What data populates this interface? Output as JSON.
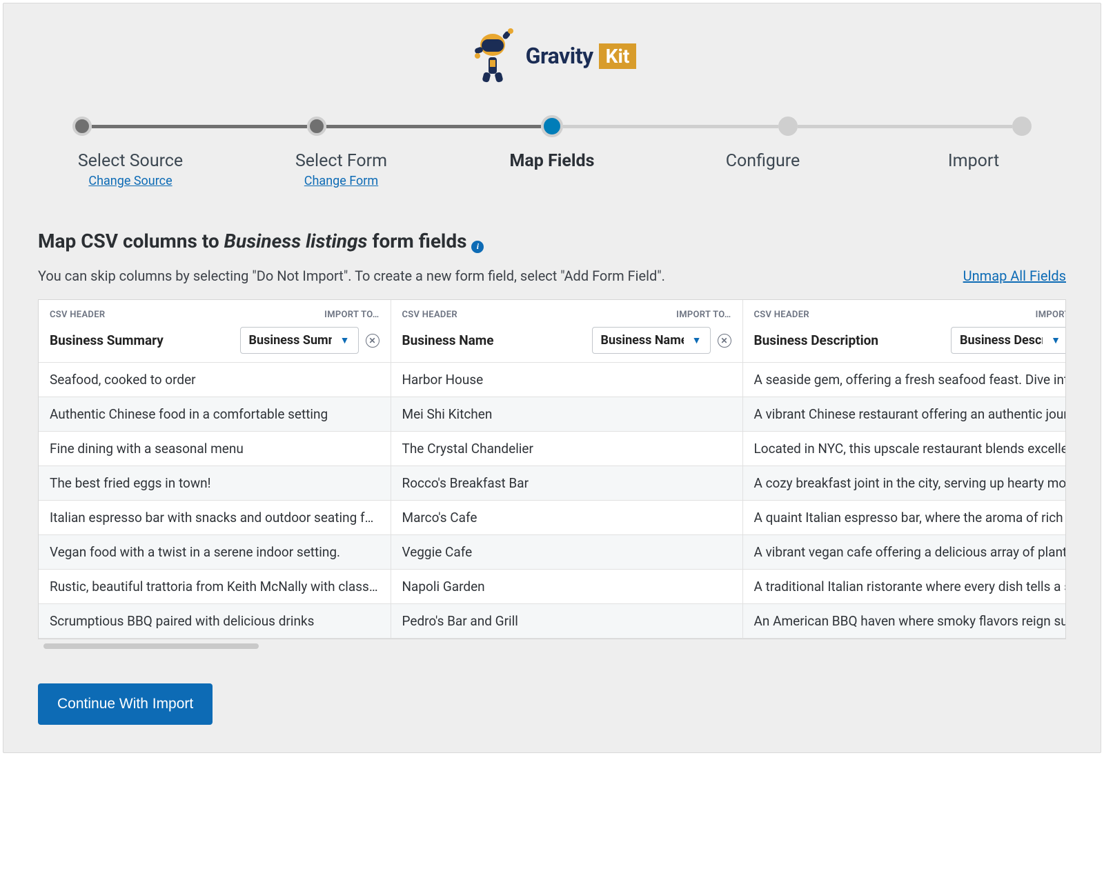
{
  "logo": {
    "brand_left": "Gravity",
    "brand_right": "Kit"
  },
  "steps": [
    {
      "title": "Select Source",
      "action": "Change Source",
      "state": "done"
    },
    {
      "title": "Select Form",
      "action": "Change Form",
      "state": "done"
    },
    {
      "title": "Map Fields",
      "action": "",
      "state": "current"
    },
    {
      "title": "Configure",
      "action": "",
      "state": "todo"
    },
    {
      "title": "Import",
      "action": "",
      "state": "todo"
    }
  ],
  "heading": {
    "prefix": "Map CSV columns to ",
    "form_name": "Business listings",
    "suffix": " form fields"
  },
  "subtext": "You can skip columns by selecting \"Do Not Import\". To create a new form field, select \"Add Form Field\".",
  "unmap_label": "Unmap All Fields",
  "labels": {
    "csv_header": "CSV HEADER",
    "import_to": "IMPORT TO…"
  },
  "columns": [
    {
      "csv_header": "Business Summary",
      "import_to": "Business Summary"
    },
    {
      "csv_header": "Business Name",
      "import_to": "Business Name"
    },
    {
      "csv_header": "Business Description",
      "import_to": "Business Description"
    }
  ],
  "rows": [
    {
      "c0": "Seafood, cooked to order",
      "c1": "Harbor House",
      "c2": "A seaside gem, offering a fresh seafood feast. Dive into the ocean's bounty."
    },
    {
      "c0": "Authentic Chinese food in a comfortable setting",
      "c1": "Mei Shi Kitchen",
      "c2": "A vibrant Chinese restaurant offering an authentic journey through flavors."
    },
    {
      "c0": "Fine dining with a seasonal menu",
      "c1": "The Crystal Chandelier",
      "c2": "Located in NYC, this upscale restaurant blends excellent service with fine dining."
    },
    {
      "c0": "The best fried eggs in town!",
      "c1": "Rocco's Breakfast Bar",
      "c2": "A cozy breakfast joint in the city, serving up hearty morning classics."
    },
    {
      "c0": "Italian espresso bar with snacks and outdoor seating for all.",
      "c1": "Marco's Cafe",
      "c2": "A quaint Italian espresso bar, where the aroma of rich coffee greets you."
    },
    {
      "c0": "Vegan food with a twist in a serene indoor setting.",
      "c1": "Veggie Cafe",
      "c2": "A vibrant vegan cafe offering a delicious array of plant-based delights."
    },
    {
      "c0": "Rustic, beautiful trattoria from Keith McNally with classic dishes.",
      "c1": "Napoli Garden",
      "c2": "A traditional Italian ristorante where every dish tells a story of home."
    },
    {
      "c0": "Scrumptious BBQ paired with delicious drinks",
      "c1": "Pedro's Bar and Grill",
      "c2": "An American BBQ haven where smoky flavors reign supreme."
    }
  ],
  "continue_label": "Continue With Import"
}
